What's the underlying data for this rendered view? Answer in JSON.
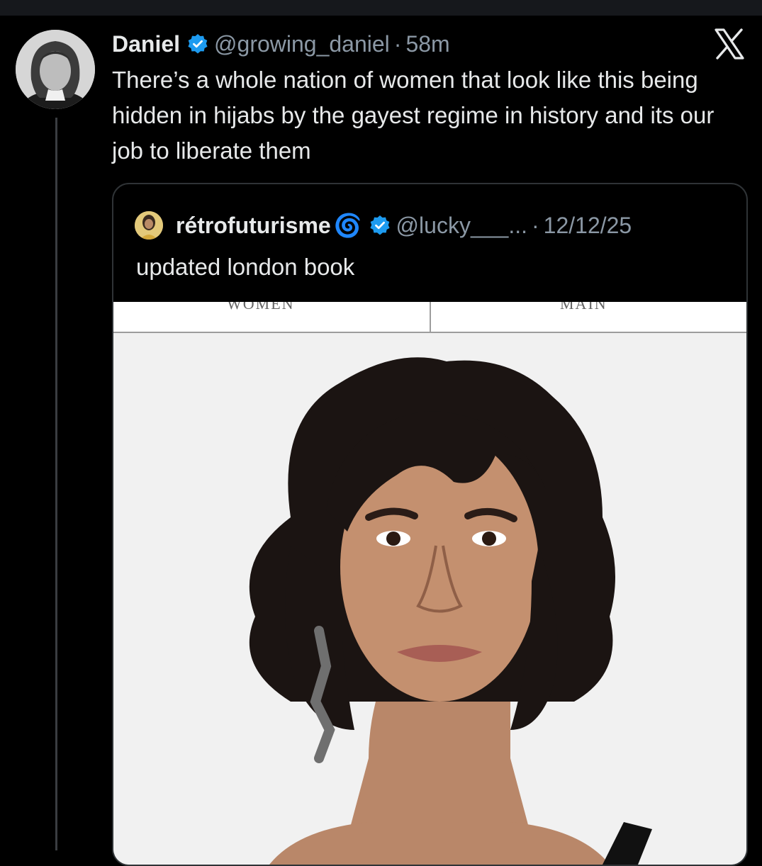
{
  "tweet": {
    "display_name": "Daniel",
    "handle": "@growing_daniel",
    "separator": "·",
    "time": "58m",
    "text": "There’s a whole nation of women that look like this being hidden in hijabs by the gayest regime in history and its our job to liberate them",
    "verified": true
  },
  "platform": {
    "logo": "x-logo-icon"
  },
  "quote": {
    "display_name": "rétrofuturisme",
    "name_emoji": "🌀",
    "handle": "@lucky___...",
    "separator": "·",
    "date": "12/12/25",
    "text": "updated london book",
    "verified": true,
    "image": {
      "nav_left": "WOMEN",
      "nav_right": "MAIN"
    }
  },
  "colors": {
    "background": "#000000",
    "text_primary": "#e7e9ea",
    "text_secondary": "#8b98a5",
    "verified_blue": "#1d9bf0",
    "border": "#2f3336"
  }
}
